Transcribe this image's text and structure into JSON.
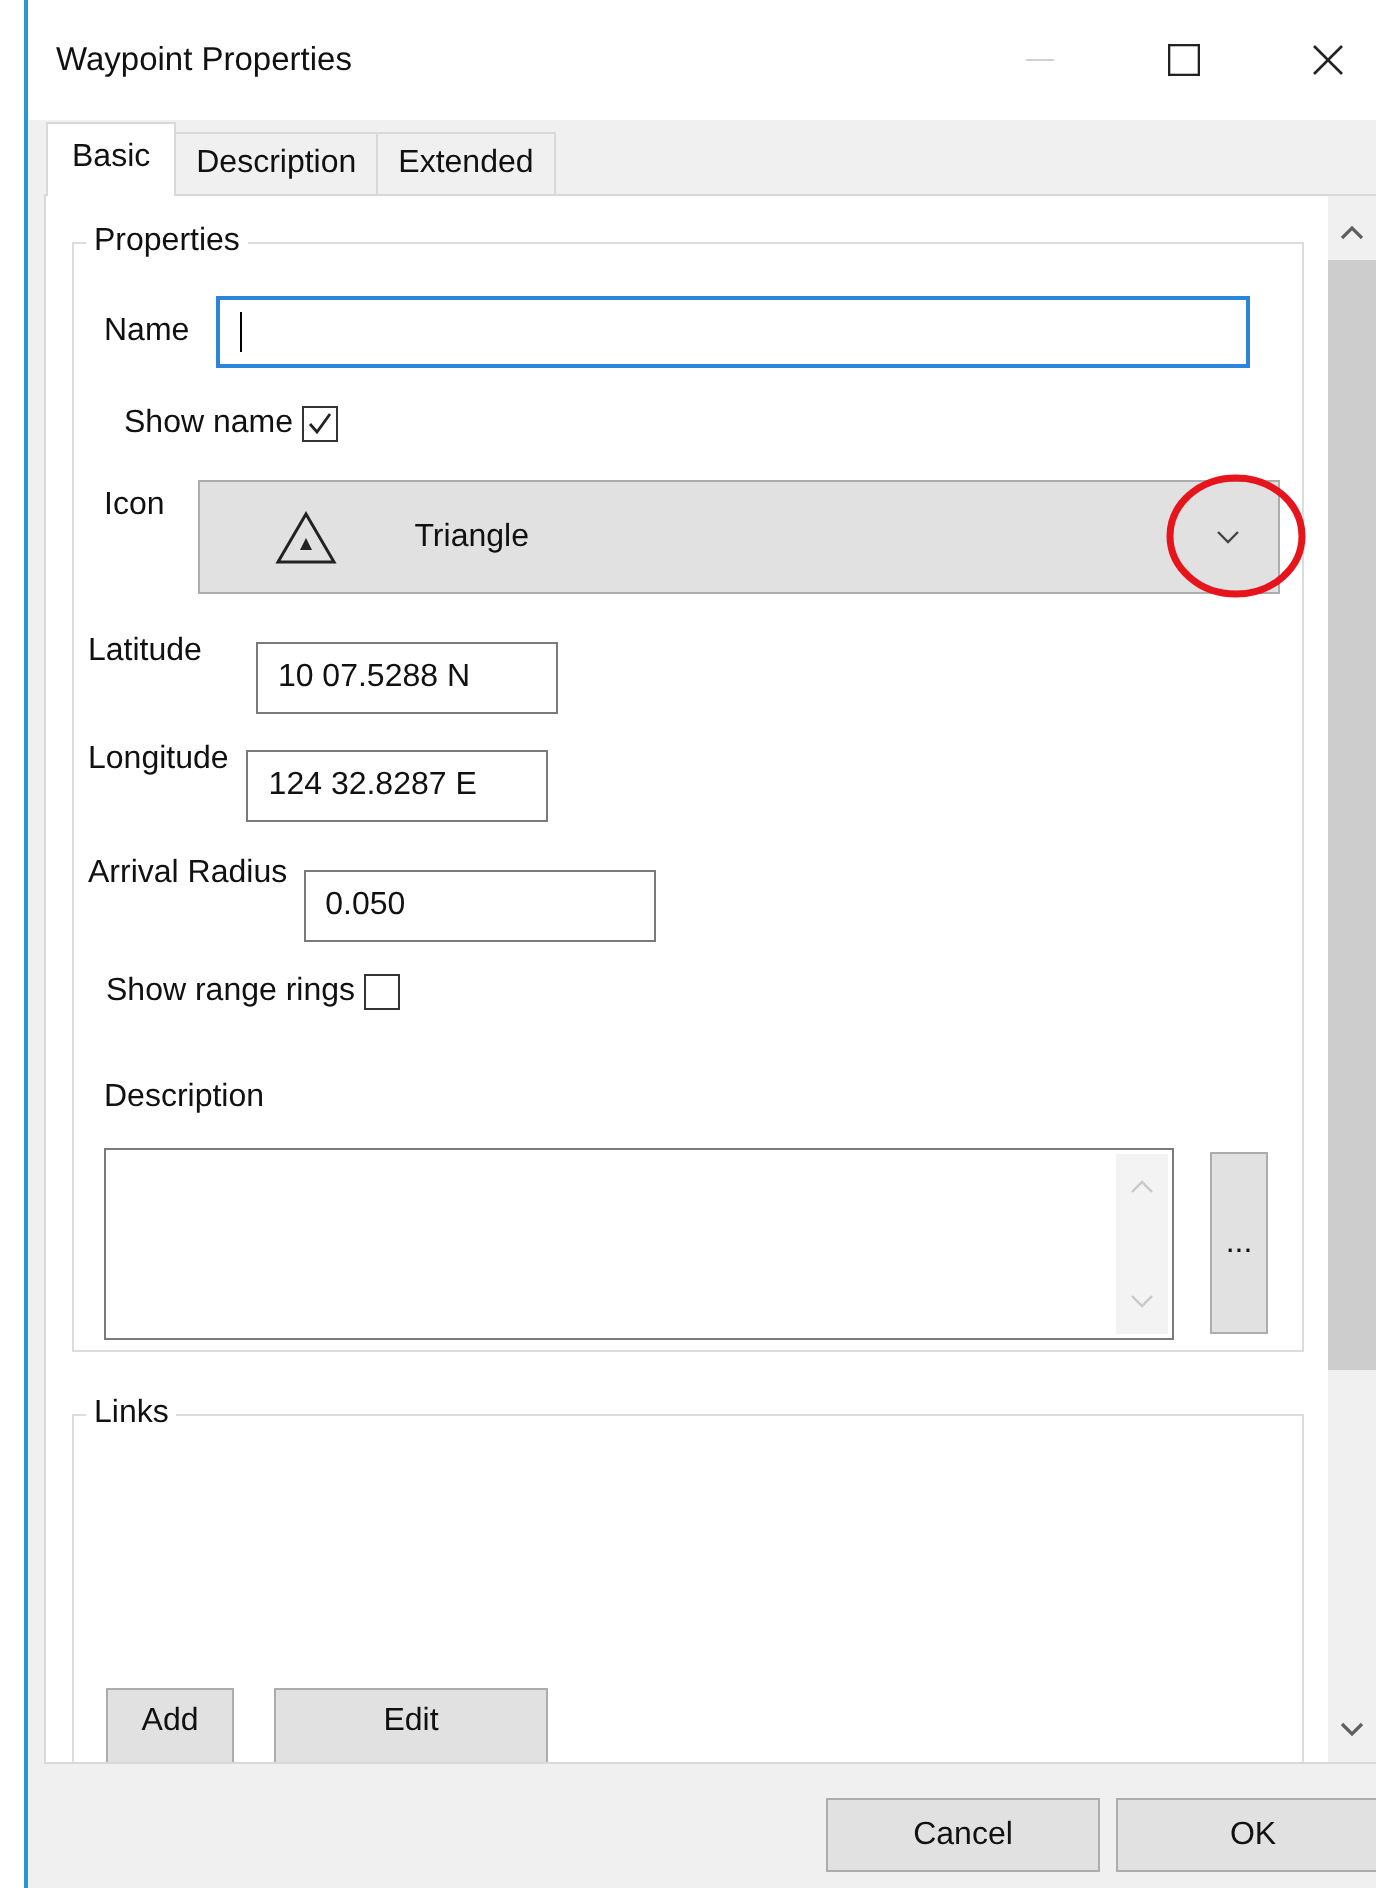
{
  "window": {
    "title": "Waypoint Properties"
  },
  "tabs": [
    {
      "label": "Basic",
      "selected": true
    },
    {
      "label": "Description",
      "selected": false
    },
    {
      "label": "Extended",
      "selected": false
    }
  ],
  "properties": {
    "legend": "Properties",
    "name": {
      "label": "Name",
      "focused": true
    },
    "show_name": {
      "label": "Show name",
      "checked": true
    },
    "icon": {
      "label": "Icon",
      "value": "Triangle",
      "annotated": true
    },
    "latitude": {
      "label": "Latitude",
      "value": "10 07.5288 N"
    },
    "longitude": {
      "label": "Longitude",
      "value": "124 32.8287 E"
    },
    "arrival_radius": {
      "label": "Arrival Radius",
      "value": "0.050"
    },
    "show_range_rings": {
      "label": "Show range rings",
      "checked": false
    },
    "description": {
      "label": "Description",
      "button": "..."
    }
  },
  "links": {
    "legend": "Links",
    "buttons": [
      "Add",
      "Edit"
    ]
  },
  "buttons": [
    "Cancel",
    "OK"
  ]
}
